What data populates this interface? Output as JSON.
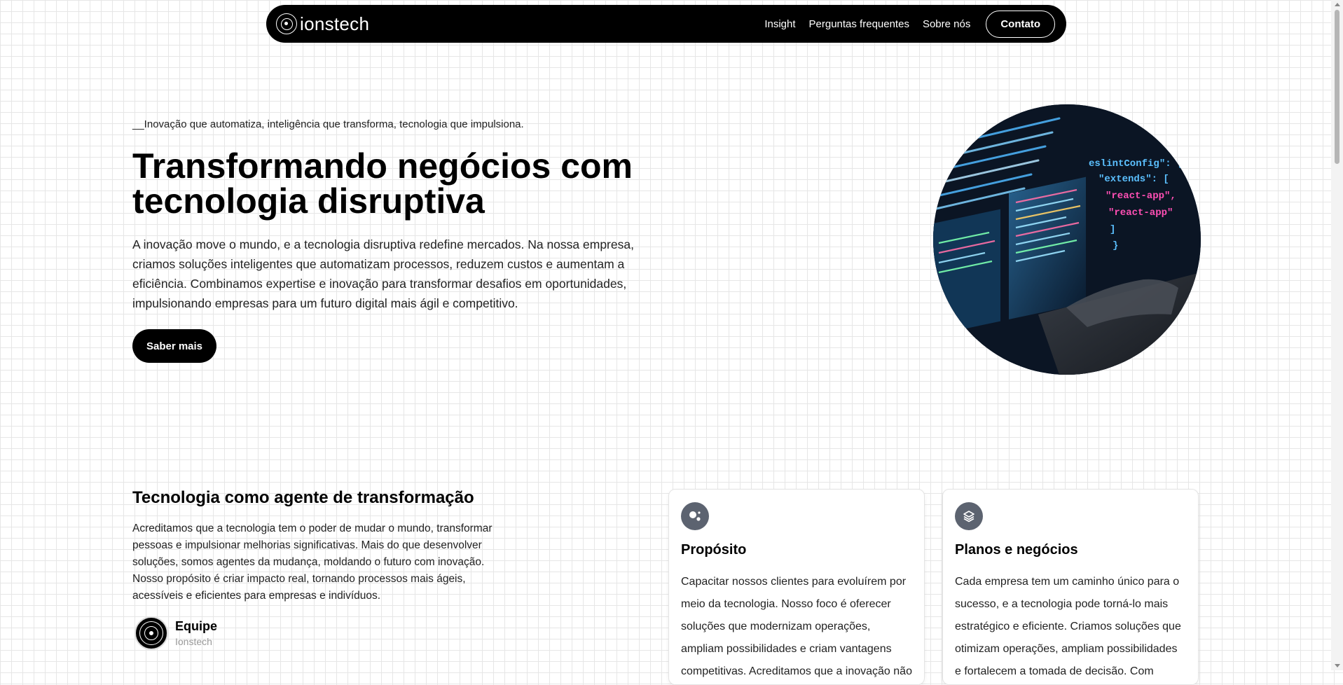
{
  "nav": {
    "brand": "ionstech",
    "links": [
      "Insight",
      "Perguntas frequentes",
      "Sobre nós"
    ],
    "contact": "Contato"
  },
  "hero": {
    "tagline": "__Inovação que automatiza, inteligência que transforma, tecnologia que impulsiona.",
    "title": "Transformando negócios com tecnologia disruptiva",
    "description": "A inovação move o mundo, e a tecnologia disruptiva redefine mercados. Na nossa empresa, criamos soluções inteligentes que automatizam processos, reduzem custos e aumentam a eficiência. Combinamos expertise e inovação para transformar desafios em oportunidades, impulsionando empresas para um futuro digital mais ágil e competitivo.",
    "button": "Saber mais",
    "code_lines": [
      "eslintConfig\": {",
      "\"extends\": [",
      "\"react-app\",",
      "\"react-app\"",
      "]",
      "}"
    ]
  },
  "about": {
    "title": "Tecnologia como agente de transformação",
    "text": "Acreditamos que a tecnologia tem o poder de mudar o mundo, transformar pessoas e impulsionar melhorias significativas. Mais do que desenvolver soluções, somos agentes da mudança, moldando o futuro com inovação. Nosso propósito é criar impacto real, tornando processos mais ágeis, acessíveis e eficientes para empresas e indivíduos.",
    "team_name": "Equipe",
    "team_sub": "Ionstech"
  },
  "cards": [
    {
      "icon": "purpose-icon",
      "title": "Propósito",
      "text": "Capacitar nossos clientes para evoluírem por meio da tecnologia. Nosso foco é oferecer soluções que modernizam operações, ampliam possibilidades e criam vantagens competitivas. Acreditamos que a inovação não"
    },
    {
      "icon": "layers-icon",
      "title": "Planos e negócios",
      "text": "Cada empresa tem um caminho único para o sucesso, e a tecnologia pode torná-lo mais estratégico e eficiente. Criamos soluções que otimizam operações, ampliam possibilidades e fortalecem a tomada de decisão. Com"
    }
  ],
  "colors": {
    "primary": "#000000",
    "icon_bg": "#5c6370",
    "code_accent": "#5bc0ff",
    "code_pink": "#ff4fb4"
  }
}
